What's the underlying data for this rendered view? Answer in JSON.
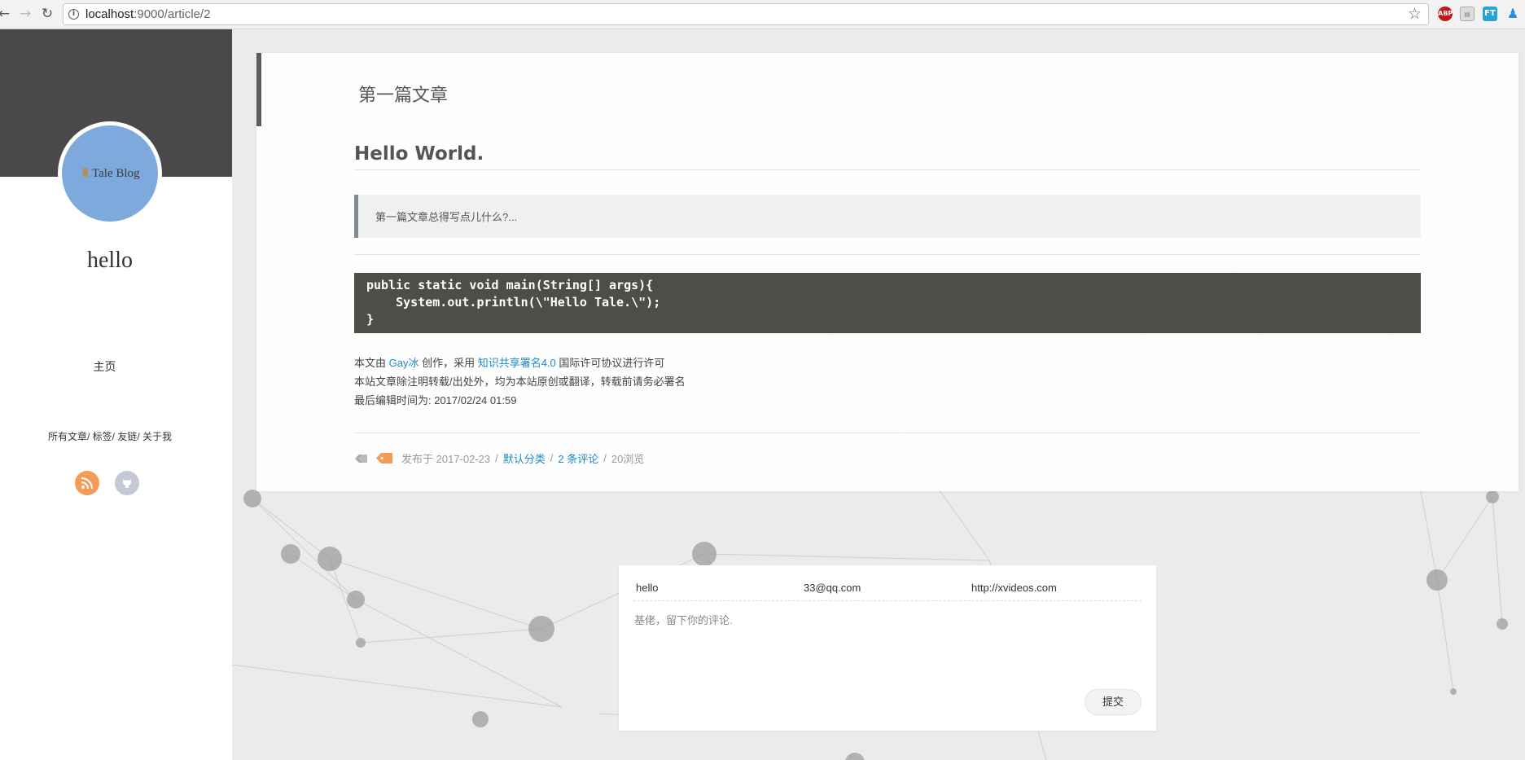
{
  "browser": {
    "url_host": "localhost",
    "url_rest": ":9000/article/2",
    "extensions": {
      "abp": "ABP",
      "ft": "FT"
    }
  },
  "sidebar": {
    "avatar_text": "Tale Blog",
    "site_name": "hello",
    "home_label": "主页",
    "links": [
      "所有文章",
      "标签",
      "友链",
      "关于我"
    ]
  },
  "article": {
    "title": "第一篇文章",
    "heading": "Hello World.",
    "quote": "第一篇文章总得写点儿什么?...",
    "code": "public static void main(String[] args){\n    System.out.println(\\\"Hello Tale.\\\");\n}",
    "license": {
      "line1_pre": "本文由 ",
      "author": "Gay冰",
      "line1_mid": " 创作，采用 ",
      "license_name": "知识共享署名4.0",
      "line1_post": " 国际许可协议进行许可",
      "line2": "本站文章除注明转载/出处外，均为本站原创或翻译，转载前请务必署名",
      "line3": "最后编辑时间为: 2017/02/24 01:59"
    },
    "meta": {
      "published": "发布于 2017-02-23",
      "category": "默认分类",
      "comments": "2 条评论",
      "views": "20浏览"
    }
  },
  "comment_form": {
    "name_value": "hello",
    "email_value": "33@qq.com",
    "url_value": "http://xvideos.com",
    "content_placeholder": "基佬，留下你的评论.",
    "submit_label": "提交"
  },
  "colors": {
    "sidebar_banner": "#494949",
    "avatar_bg": "#7da9dc",
    "link": "#1e8bc8",
    "code_bg": "#4e4e48",
    "rss": "#f39c5a"
  }
}
